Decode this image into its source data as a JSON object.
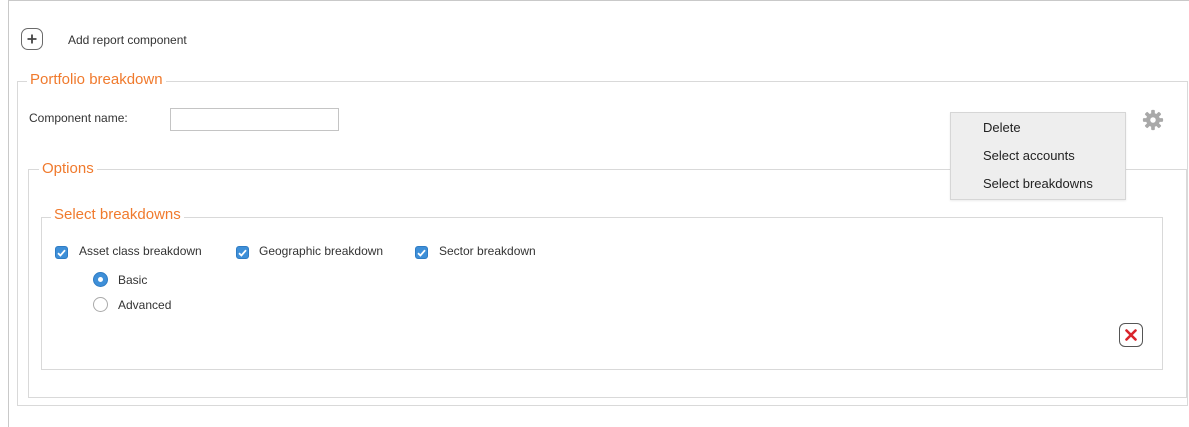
{
  "toolbar": {
    "add_label": "Add report component"
  },
  "component": {
    "title": "Portfolio breakdown",
    "name_label": "Component name:",
    "name_value": "",
    "name_placeholder": ""
  },
  "menu": {
    "items": [
      "Delete",
      "Select accounts",
      "Select breakdowns"
    ]
  },
  "options": {
    "title": "Options",
    "select_breakdowns": {
      "title": "Select breakdowns",
      "checkboxes": [
        {
          "label": "Asset class breakdown",
          "checked": true
        },
        {
          "label": "Geographic breakdown",
          "checked": true
        },
        {
          "label": "Sector breakdown",
          "checked": true
        }
      ],
      "radios": [
        {
          "label": "Basic",
          "selected": true
        },
        {
          "label": "Advanced",
          "selected": false
        }
      ]
    }
  },
  "icons": {
    "add": "plus-icon",
    "settings": "gear-icon",
    "remove": "close-icon"
  },
  "colors": {
    "accent": "#f07a2d",
    "checkbox": "#3e8fd8",
    "remove": "#d9242b",
    "menu_bg": "#eeeeee"
  }
}
